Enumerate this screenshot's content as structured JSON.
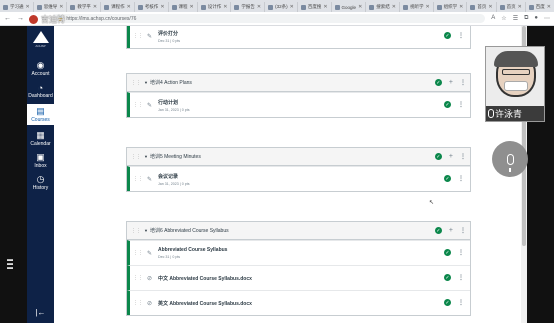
{
  "browser": {
    "tabs": [
      {
        "label": "学习通"
      },
      {
        "label": "思维导"
      },
      {
        "label": "教学平"
      },
      {
        "label": "课程作"
      },
      {
        "label": "考核作"
      },
      {
        "label": "课程"
      },
      {
        "label": "设计作"
      },
      {
        "label": "学报告"
      },
      {
        "label": "(32条)"
      },
      {
        "label": "百度搜"
      },
      {
        "label": "Google"
      },
      {
        "label": "搜索结"
      },
      {
        "label": "视听学"
      },
      {
        "label": "组织学"
      },
      {
        "label": "首页"
      },
      {
        "label": "首页"
      },
      {
        "label": "百度"
      },
      {
        "label": "Canvas",
        "active": true
      },
      {
        "label": "标签页"
      },
      {
        "label": "标签页"
      }
    ],
    "url": "https://lms.achsp.cn/courses/76",
    "new_tab": "+",
    "overlay_text": "吉迪特"
  },
  "global_nav": {
    "brand_caption": "ACHSP",
    "items": [
      {
        "label": "Account",
        "icon": "account-icon"
      },
      {
        "label": "Dashboard",
        "icon": "dashboard-icon"
      },
      {
        "label": "Courses",
        "icon": "courses-icon",
        "active": true
      },
      {
        "label": "Calendar",
        "icon": "calendar-icon"
      },
      {
        "label": "Inbox",
        "icon": "inbox-icon"
      },
      {
        "label": "History",
        "icon": "history-icon"
      }
    ]
  },
  "modules": [
    {
      "title": "",
      "items": [
        {
          "title": "评价打分",
          "meta": "Dec 31 | 0 pts",
          "type": "assignment"
        }
      ]
    },
    {
      "title": "培训4 Action Plans",
      "items": [
        {
          "title": "行动计划",
          "meta": "Jan 31, 2023 | 0 pts",
          "type": "assignment"
        }
      ]
    },
    {
      "title": "培训5 Meeting Minutes",
      "items": [
        {
          "title": "会议记录",
          "meta": "Jan 31, 2023 | 0 pts",
          "type": "assignment"
        }
      ]
    },
    {
      "title": "培训6 Abbreviated Course Syllabus",
      "items": [
        {
          "title": "Abbreviated Course Syllabus",
          "meta": "Dec 31 | 0 pts",
          "type": "assignment"
        },
        {
          "title": "中文 Abbreviated Course Syllabus.docx",
          "meta": "",
          "type": "attachment"
        },
        {
          "title": "英文 Abbreviated Course Syllabus.docx",
          "meta": "",
          "type": "attachment"
        }
      ]
    }
  ],
  "video": {
    "name": "许泳青"
  }
}
